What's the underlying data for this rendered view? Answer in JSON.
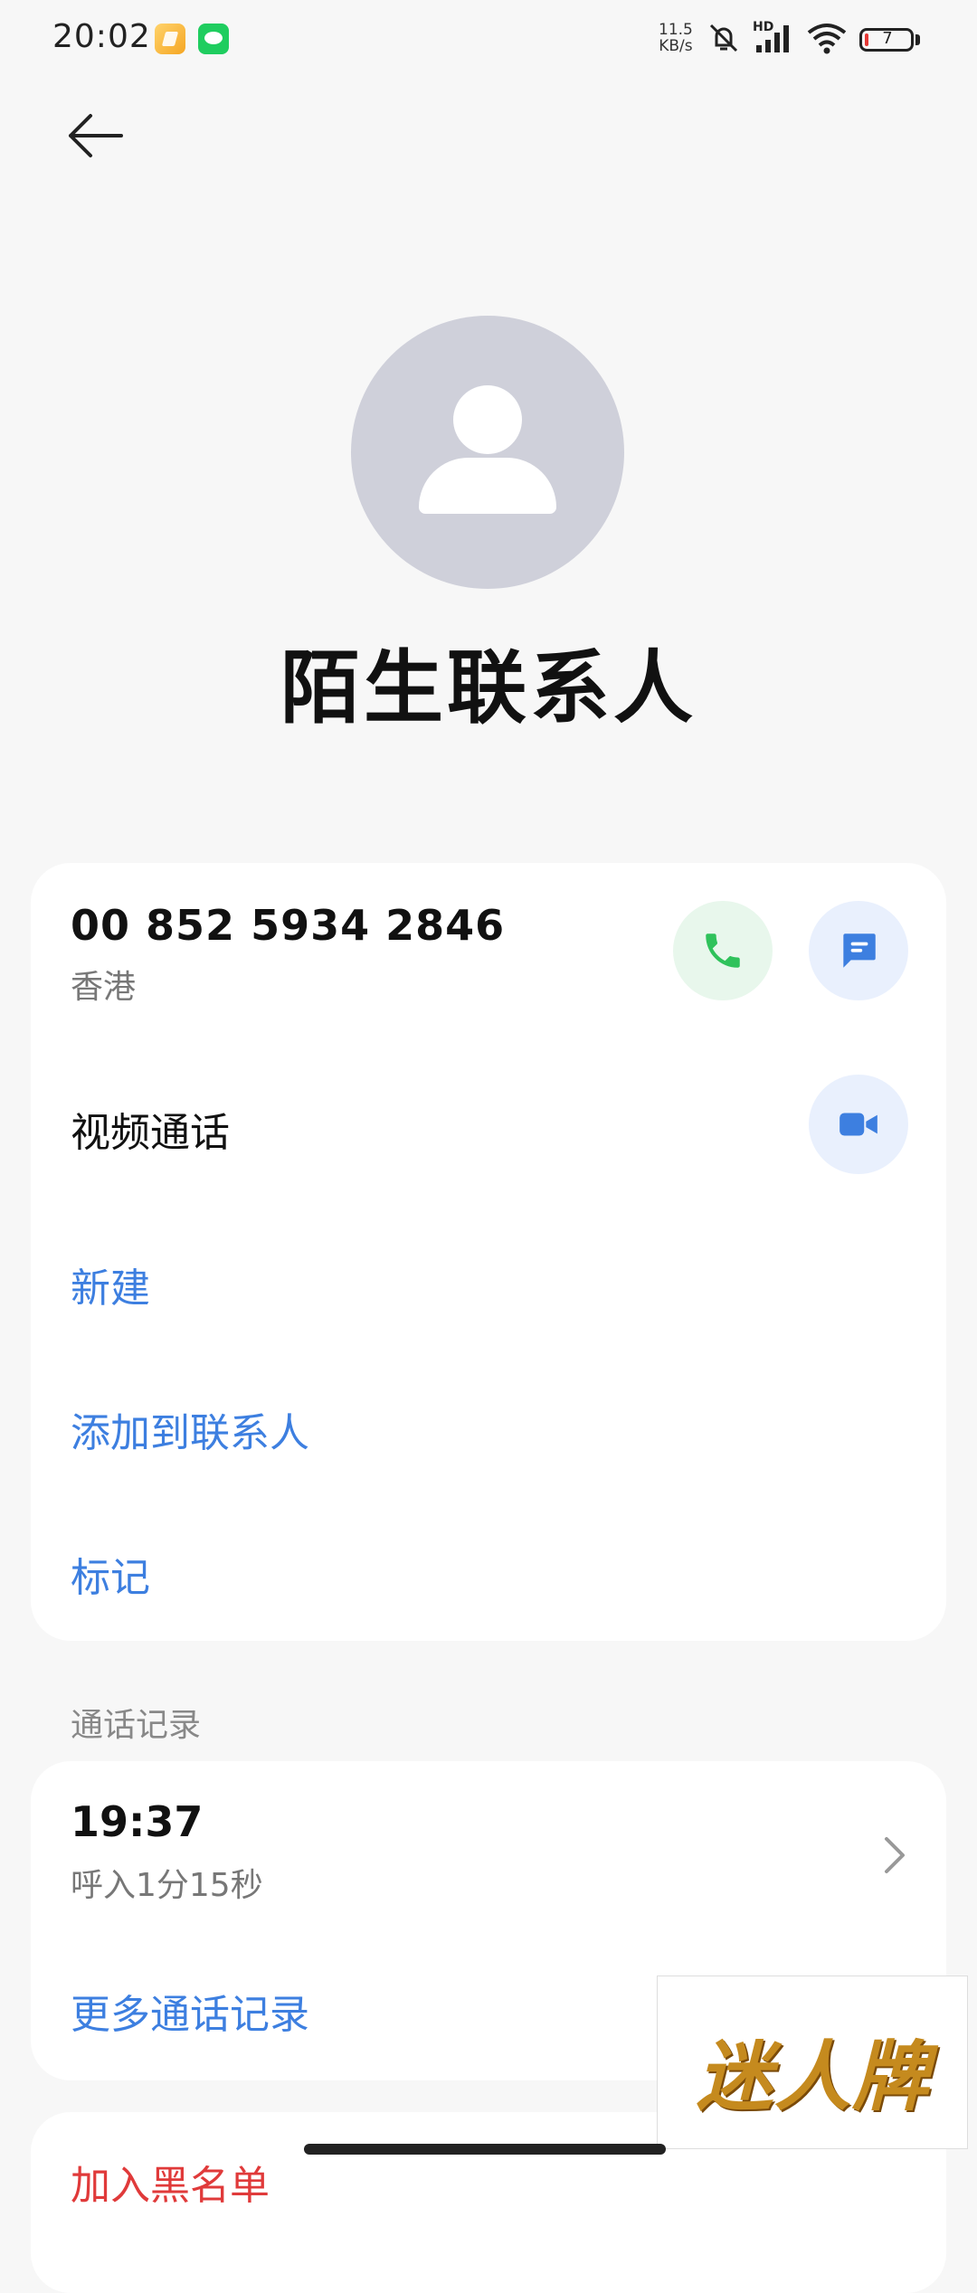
{
  "status_bar": {
    "time": "20:02",
    "net_speed_value": "11.5",
    "net_speed_unit": "KB/s",
    "hd_label": "HD",
    "battery_level": "7",
    "icons": [
      "notes-app-icon",
      "wechat-icon",
      "mute-vibrate-icon",
      "signal-icon",
      "wifi-icon",
      "battery-icon"
    ]
  },
  "header": {
    "back_icon": "arrow-left-icon"
  },
  "contact": {
    "name": "陌生联系人",
    "avatar_icon": "person-icon"
  },
  "phone": {
    "number": "00 852 5934 2846",
    "region": "香港"
  },
  "video_call": {
    "label": "视频通话"
  },
  "actions": {
    "new": "新建",
    "add_to_contacts": "添加到联系人",
    "mark": "标记"
  },
  "call_log": {
    "section_title": "通话记录",
    "entries": [
      {
        "time": "19:37",
        "detail": "呼入1分15秒"
      }
    ],
    "more_label": "更多通话记录"
  },
  "bottom_card": {
    "text": "加入黑名单"
  },
  "watermark": {
    "text": "迷人牌"
  },
  "colors": {
    "accent_blue": "#3d7fe0",
    "call_green": "#2fc25b",
    "danger_red": "#e03a3a",
    "avatar_bg": "#cfd0da"
  }
}
